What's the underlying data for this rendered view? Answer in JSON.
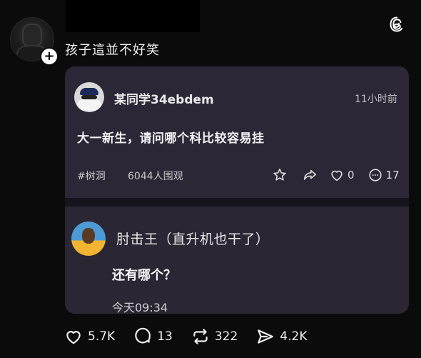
{
  "post": {
    "text": "孩子這並不好笑",
    "follow_symbol": "+"
  },
  "embedded_card": {
    "user": "某同学34ebdem",
    "time": "11小时前",
    "body": "大一新生，请问哪个科比较容易挂",
    "tag": "#树洞",
    "views": "6044人围观",
    "likes": "0",
    "comments": "17",
    "reply": {
      "user": "肘击王（直升机也干了）",
      "body": "还有哪个？",
      "time": "今天09:34"
    }
  },
  "footer": {
    "likes": "5.7K",
    "replies": "13",
    "reposts": "322",
    "shares": "4.2K"
  },
  "colors": {
    "background": "#0b0b0b",
    "card": "#2a2634",
    "text": "#f2f2f2"
  },
  "icons": [
    "threads-icon",
    "star-icon",
    "share-arrow-icon",
    "heart-icon",
    "comment-bubble-icon",
    "repost-icon",
    "send-icon"
  ]
}
